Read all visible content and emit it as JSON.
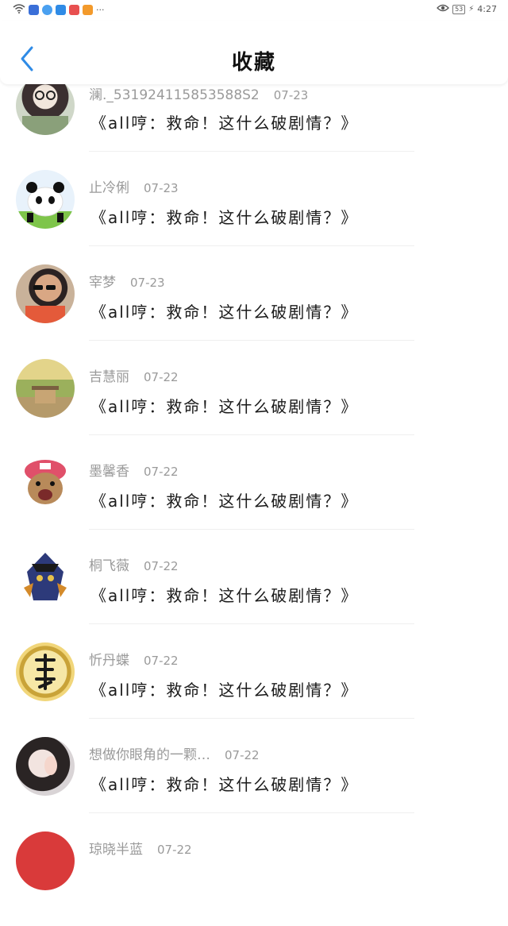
{
  "status_bar": {
    "battery": "53",
    "time": "4:27",
    "more": "···"
  },
  "header": {
    "title": "收藏"
  },
  "items": [
    {
      "name": "澜._531924115853588S2",
      "date": "07-23",
      "title": "《all哼：救命！这什么破剧情？》",
      "avatar": "avatar-photo-glasses"
    },
    {
      "name": "止冷俐",
      "date": "07-23",
      "title": "《all哼：救命！这什么破剧情？》",
      "avatar": "avatar-panda"
    },
    {
      "name": "宰梦",
      "date": "07-23",
      "title": "《all哼：救命！这什么破剧情？》",
      "avatar": "avatar-sunglasses"
    },
    {
      "name": "吉慧丽",
      "date": "07-22",
      "title": "《all哼：救命！这什么破剧情？》",
      "avatar": "avatar-landscape"
    },
    {
      "name": "墨馨香",
      "date": "07-22",
      "title": "《all哼：救命！这什么破剧情？》",
      "avatar": "avatar-cartoon-chopper"
    },
    {
      "name": "桐飞薇",
      "date": "07-22",
      "title": "《all哼：救命！这什么破剧情？》",
      "avatar": "avatar-game-character"
    },
    {
      "name": "忻丹蝶",
      "date": "07-22",
      "title": "《all哼：救命！这什么破剧情？》",
      "avatar": "avatar-fu-coin"
    },
    {
      "name": "想做你眼角的一颗…",
      "date": "07-22",
      "title": "《all哼：救命！这什么破剧情？》",
      "avatar": "avatar-girl-photo"
    },
    {
      "name": "琼晓半蓝",
      "date": "07-22",
      "title": "",
      "avatar": "avatar-red"
    }
  ],
  "colors": {
    "accent": "#2f8be6",
    "muted_text": "#9a9a9a",
    "divider": "#efefef"
  }
}
